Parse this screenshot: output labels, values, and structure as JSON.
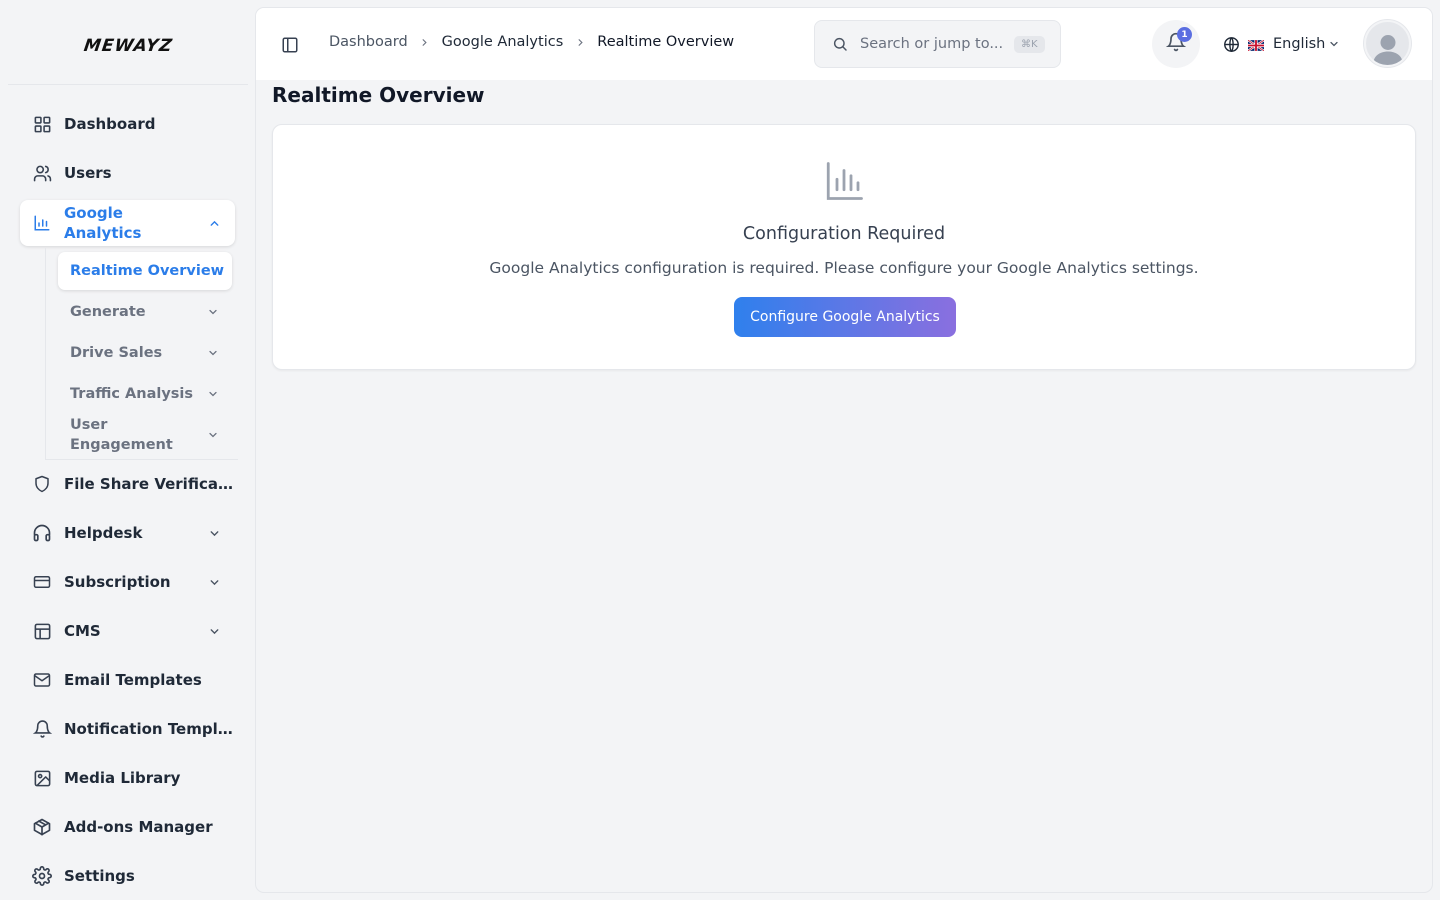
{
  "brand": {
    "name": "MEWAYZ"
  },
  "sidebar": {
    "items": [
      {
        "label": "Dashboard",
        "icon": "grid-icon"
      },
      {
        "label": "Users",
        "icon": "users-icon"
      },
      {
        "label": "Google Analytics",
        "icon": "bar-chart-icon",
        "expanded": true
      },
      {
        "label": "File Share Verification",
        "icon": "shield-icon"
      },
      {
        "label": "Helpdesk",
        "icon": "headset-icon"
      },
      {
        "label": "Subscription",
        "icon": "credit-card-icon"
      },
      {
        "label": "CMS",
        "icon": "layout-icon"
      },
      {
        "label": "Email Templates",
        "icon": "mail-icon"
      },
      {
        "label": "Notification Templates",
        "icon": "bell-icon"
      },
      {
        "label": "Media Library",
        "icon": "image-icon"
      },
      {
        "label": "Add-ons Manager",
        "icon": "package-icon"
      },
      {
        "label": "Settings",
        "icon": "gear-icon"
      }
    ],
    "analytics_sub": [
      {
        "label": "Realtime Overview"
      },
      {
        "label": "Generate"
      },
      {
        "label": "Drive Sales"
      },
      {
        "label": "Traffic Analysis"
      },
      {
        "label": "User Engagement"
      }
    ]
  },
  "header": {
    "breadcrumbs": [
      "Dashboard",
      "Google Analytics",
      "Realtime Overview"
    ],
    "search_placeholder": "Search or jump to...",
    "search_shortcut": "⌘K",
    "notifications_count": "1",
    "language": "English"
  },
  "main": {
    "title": "Realtime Overview",
    "empty_state": {
      "heading": "Configuration Required",
      "message": "Google Analytics configuration is required. Please configure your Google Analytics settings.",
      "button": "Configure Google Analytics"
    }
  },
  "colors": {
    "accent": "#2b7de9",
    "button_gradient_start": "#2f80ed",
    "button_gradient_end": "#8a6fdf",
    "badge": "#5b6ee1"
  }
}
